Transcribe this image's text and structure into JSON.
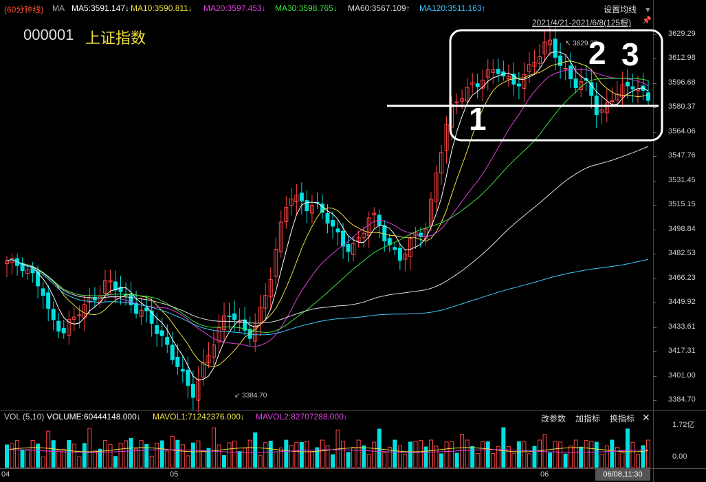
{
  "header": {
    "period": "(60分钟线)",
    "ma_prefix": "MA",
    "ma5": "MA5:3591.147↓",
    "ma10": "MA10:3590.811↓",
    "ma20": "MA20:3597.453↓",
    "ma30": "MA30:3598.765↓",
    "ma60": "MA60:3567.109↑",
    "ma120": "MA120:3511.163↑",
    "settings_label": "设置均线",
    "range_label": "2021/4/21-2021/6/8(125根)"
  },
  "stock": {
    "code": "000001",
    "name": "上证指数"
  },
  "price_axis": [
    "3629.29",
    "3612.98",
    "3596.68",
    "3580.37",
    "3564.06",
    "3547.76",
    "3531.45",
    "3515.15",
    "3498.84",
    "3482.53",
    "3466.23",
    "3449.92",
    "3433.61",
    "3417.31",
    "3401.00",
    "3384.70"
  ],
  "annotations": {
    "high": "3629.29",
    "low": "3384.70"
  },
  "markers": [
    "1",
    "2",
    "3"
  ],
  "volume_bar": {
    "title": "VOL (5,10)",
    "volume": "VOLUME:60444148.000↓",
    "mavol1": "MAVOL1:71242376.000↓",
    "mavol2": "MAVOL2:82707288.000↓",
    "btn_params": "改参数",
    "btn_add": "加指标",
    "btn_switch": "换指标",
    "close": "✕",
    "axis": [
      "1.72亿",
      "0.00"
    ]
  },
  "date_axis": {
    "ticks": [
      "04",
      "05",
      "06"
    ],
    "cursor": "06/08,11:30"
  },
  "colors": {
    "up": "#ff4545",
    "down": "#00e0e0",
    "ma5": "#ffffff",
    "ma10": "#f0e040",
    "ma20": "#e040e0",
    "ma30": "#40e040",
    "ma60": "#dddddd",
    "ma120": "#40c8ff"
  },
  "chart_data": {
    "type": "candlestick",
    "title": "上证指数",
    "period": "60分钟线",
    "ylim": [
      3384.7,
      3629.29
    ],
    "bars": 125,
    "date_range": [
      "2021-04-21",
      "2021-06-08"
    ],
    "close_path": [
      3478,
      3476,
      3475,
      3470,
      3466,
      3458,
      3440,
      3435,
      3430,
      3438,
      3444,
      3448,
      3452,
      3456,
      3464,
      3462,
      3458,
      3450,
      3446,
      3444,
      3440,
      3432,
      3424,
      3416,
      3408,
      3398,
      3388,
      3400,
      3412,
      3424,
      3434,
      3444,
      3440,
      3432,
      3428,
      3436,
      3450,
      3468,
      3490,
      3514,
      3522,
      3518,
      3514,
      3516,
      3512,
      3506,
      3498,
      3490,
      3486,
      3488,
      3498,
      3510,
      3504,
      3494,
      3486,
      3478,
      3486,
      3494,
      3496,
      3502,
      3530,
      3554,
      3576,
      3584,
      3590,
      3594,
      3596,
      3602,
      3604,
      3606,
      3600,
      3596,
      3598,
      3604,
      3612,
      3618,
      3626,
      3616,
      3606,
      3600,
      3596,
      3598,
      3590,
      3574,
      3580,
      3588,
      3592,
      3594,
      3596,
      3590,
      3586
    ]
  }
}
